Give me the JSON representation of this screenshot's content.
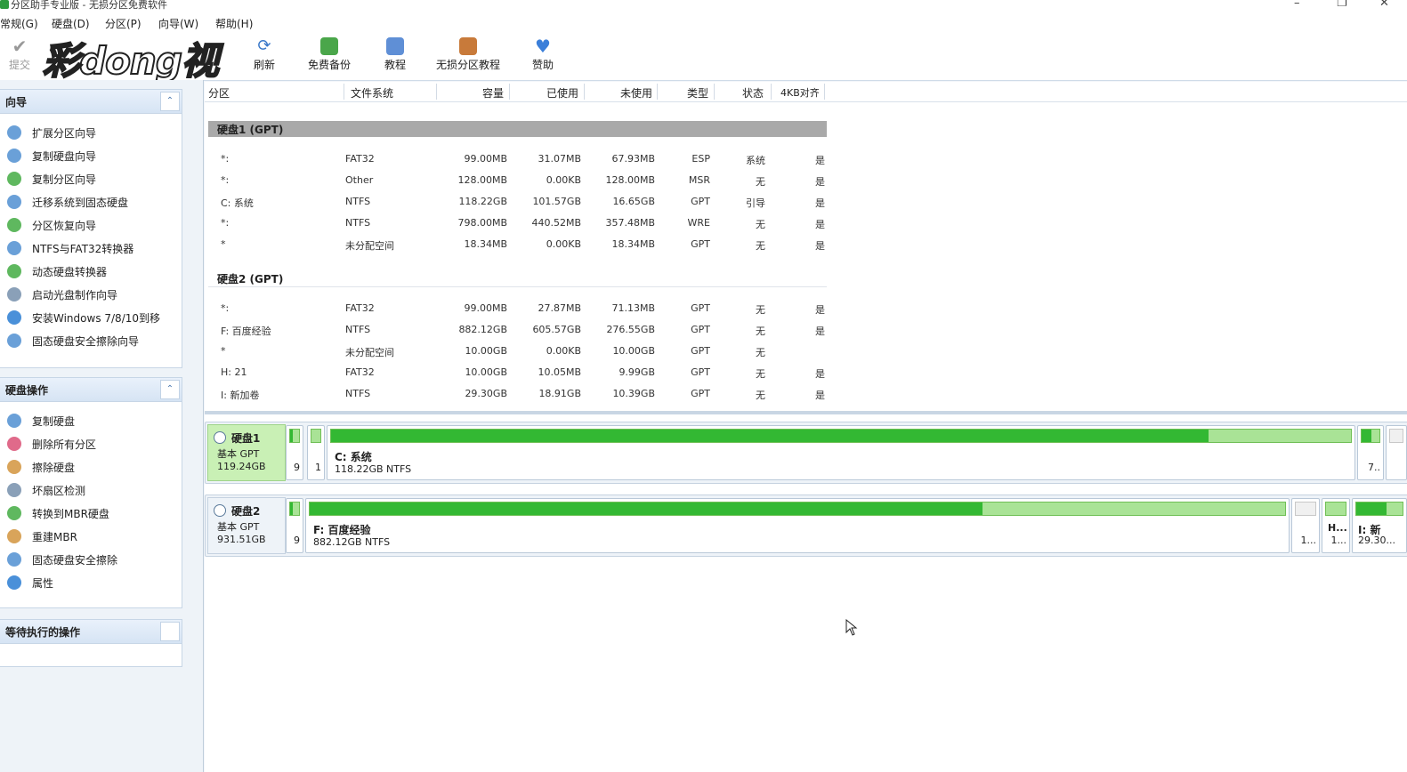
{
  "window": {
    "title": "分区助手专业版 - 无损分区免费软件"
  },
  "menu": [
    "常规(G)",
    "硬盘(D)",
    "分区(P)",
    "向导(W)",
    "帮助(H)"
  ],
  "toolbar": {
    "commit": "提交",
    "refresh": "刷新",
    "backup": "免费备份",
    "tutorial": "教程",
    "lossless_tutorial": "无损分区教程",
    "donate": "赞助"
  },
  "watermark": "彩dong视频",
  "wizard_panel": {
    "title": "向导",
    "items": [
      "扩展分区向导",
      "复制硬盘向导",
      "复制分区向导",
      "迁移系统到固态硬盘",
      "分区恢复向导",
      "NTFS与FAT32转换器",
      "动态硬盘转换器",
      "启动光盘制作向导",
      "安装Windows 7/8/10到移",
      "固态硬盘安全擦除向导"
    ]
  },
  "disk_ops_panel": {
    "title": "硬盘操作",
    "items": [
      "复制硬盘",
      "删除所有分区",
      "擦除硬盘",
      "坏扇区检测",
      "转换到MBR硬盘",
      "重建MBR",
      "固态硬盘安全擦除",
      "属性"
    ]
  },
  "pending_panel": {
    "title": "等待执行的操作"
  },
  "columns": [
    "分区",
    "文件系统",
    "容量",
    "已使用",
    "未使用",
    "类型",
    "状态",
    "4KB对齐"
  ],
  "disks": [
    {
      "header": "硬盘1 (GPT)",
      "rows": [
        [
          "*:",
          "FAT32",
          "99.00MB",
          "31.07MB",
          "67.93MB",
          "ESP",
          "系统",
          "是"
        ],
        [
          "*:",
          "Other",
          "128.00MB",
          "0.00KB",
          "128.00MB",
          "MSR",
          "无",
          "是"
        ],
        [
          "C: 系统",
          "NTFS",
          "118.22GB",
          "101.57GB",
          "16.65GB",
          "GPT",
          "引导",
          "是"
        ],
        [
          "*:",
          "NTFS",
          "798.00MB",
          "440.52MB",
          "357.48MB",
          "WRE",
          "无",
          "是"
        ],
        [
          "*",
          "未分配空间",
          "18.34MB",
          "0.00KB",
          "18.34MB",
          "GPT",
          "无",
          "是"
        ]
      ]
    },
    {
      "header": "硬盘2 (GPT)",
      "rows": [
        [
          "*:",
          "FAT32",
          "99.00MB",
          "27.87MB",
          "71.13MB",
          "GPT",
          "无",
          "是"
        ],
        [
          "F: 百度经验",
          "NTFS",
          "882.12GB",
          "605.57GB",
          "276.55GB",
          "GPT",
          "无",
          "是"
        ],
        [
          "*",
          "未分配空间",
          "10.00GB",
          "0.00KB",
          "10.00GB",
          "GPT",
          "无",
          ""
        ],
        [
          "H: 21",
          "FAT32",
          "10.00GB",
          "10.05MB",
          "9.99GB",
          "GPT",
          "无",
          "是"
        ],
        [
          "I: 新加卷",
          "NTFS",
          "29.30GB",
          "18.91GB",
          "10.39GB",
          "GPT",
          "无",
          "是"
        ]
      ]
    }
  ],
  "diskmap": [
    {
      "name": "硬盘1",
      "type": "基本 GPT",
      "size": "119.24GB",
      "parts": [
        {
          "label": "",
          "small": "9",
          "used": 0.31
        },
        {
          "label": "",
          "small": "1",
          "used": 0.0
        },
        {
          "label": "C: 系统",
          "detail": "118.22GB NTFS",
          "used": 0.86
        },
        {
          "label": "",
          "small": "7..",
          "used": 0.55
        },
        {
          "label": "",
          "small": "",
          "used": 0.0
        }
      ]
    },
    {
      "name": "硬盘2",
      "type": "基本 GPT",
      "size": "931.51GB",
      "parts": [
        {
          "label": "",
          "small": "9",
          "used": 0.28
        },
        {
          "label": "F: 百度经验",
          "detail": "882.12GB NTFS",
          "used": 0.69
        },
        {
          "label": "",
          "small": "1...",
          "used": 0.0
        },
        {
          "label": "H...",
          "small": "1...",
          "used": 0.0
        },
        {
          "label": "I: 新",
          "small": "29.30...",
          "used": 0.65
        }
      ]
    }
  ],
  "colors": {
    "accent": "#33b833",
    "light_green": "#a9e396",
    "header_gray": "#a9a9a9"
  }
}
